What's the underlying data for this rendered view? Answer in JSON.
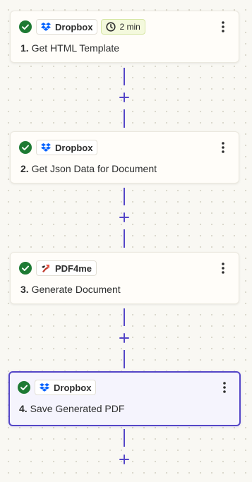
{
  "steps": [
    {
      "number": "1.",
      "title": "Get HTML Template",
      "app": "Dropbox",
      "duration": "2 min",
      "status": "completed"
    },
    {
      "number": "2.",
      "title": "Get Json Data for Document",
      "app": "Dropbox",
      "status": "completed"
    },
    {
      "number": "3.",
      "title": "Generate Document",
      "app": "PDF4me",
      "status": "completed"
    },
    {
      "number": "4.",
      "title": "Save Generated PDF",
      "app": "Dropbox",
      "status": "completed",
      "selected": true
    }
  ],
  "icons": {
    "status": "check-circle-icon",
    "dropbox": "dropbox-icon",
    "pdf4me": "pdf4me-icon",
    "duration": "clock-icon",
    "menu": "more-vertical-icon",
    "add": "plus-icon"
  },
  "colors": {
    "accent": "#5446c7",
    "success": "#1e7a33",
    "dropbox": "#0061fe",
    "duration_chip": "#f4f9dd",
    "selected_card": "#f5f4fd",
    "canvas": "#f9f8f3"
  }
}
